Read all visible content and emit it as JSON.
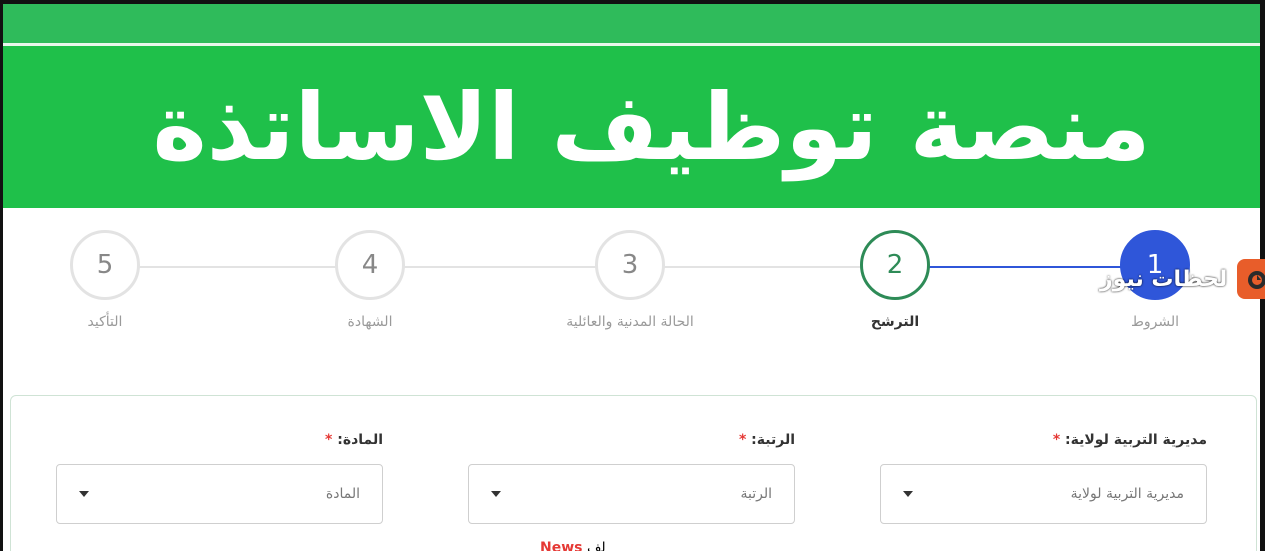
{
  "banner": {
    "title": "منصة توظيف الاساتذة"
  },
  "steps": [
    {
      "number": "1",
      "label": "الشروط"
    },
    {
      "number": "2",
      "label": "الترشح"
    },
    {
      "number": "3",
      "label": "الحالة المدنية والعائلية"
    },
    {
      "number": "4",
      "label": "الشهادة"
    },
    {
      "number": "5",
      "label": "التأكيد"
    }
  ],
  "watermark": {
    "text": "لحظات نيوز"
  },
  "form": {
    "fields": [
      {
        "label": "مديرية التربية لولاية:",
        "required": "*",
        "value": "مديرية التربية لولاية"
      },
      {
        "label": "الرتبة:",
        "required": "*",
        "value": "الرتبة"
      },
      {
        "label": "المادة:",
        "required": "*",
        "value": "المادة"
      }
    ]
  },
  "footer_note": {
    "prefix": "لف",
    "news": "News"
  },
  "colors": {
    "banner": "#1fc04a",
    "step_done": "#2f56d9",
    "step_active": "#2e8b57",
    "required": "#e53935"
  }
}
